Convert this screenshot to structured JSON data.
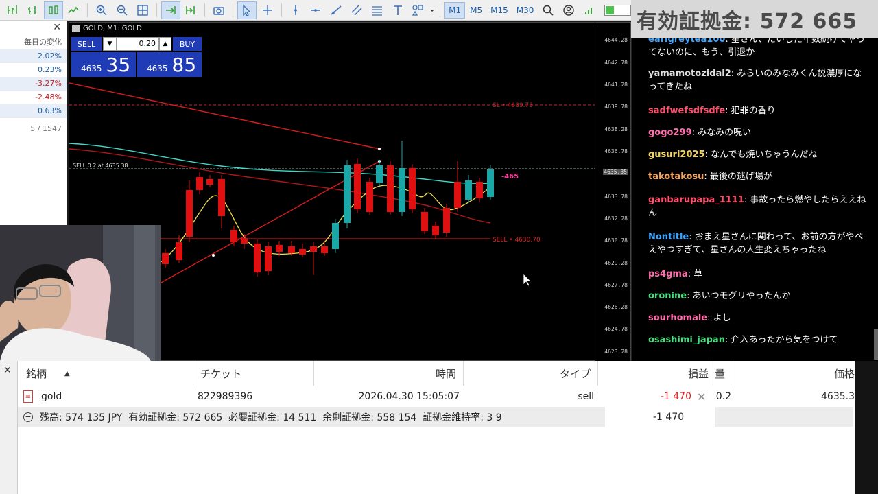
{
  "toolbar": {
    "timeframes": [
      "M1",
      "M5",
      "M15",
      "M30"
    ],
    "selected_timeframe": "M1"
  },
  "overlay": {
    "margin_text": "有効証拠金: 572 665"
  },
  "market_watch": {
    "header": "毎日の変化",
    "changes": [
      "2.02%",
      "0.23%",
      "-3.27%",
      "-2.48%",
      "0.63%"
    ],
    "footer": "5 / 1547"
  },
  "chart": {
    "title": "GOLD, M1: GOLD",
    "position_label": "SELL 0.2 at 4635.38",
    "sl_label": "SL • 4639.75",
    "sell_label": "SELL • 4630.70",
    "pnl_label": "-465",
    "price_ticks": [
      "4644.28",
      "4642.78",
      "4641.28",
      "4639.78",
      "4638.28",
      "4636.78",
      "4635.35",
      "4633.78",
      "4632.28",
      "4630.78",
      "4629.28",
      "4627.78",
      "4626.28",
      "4624.78",
      "4623.28"
    ],
    "current_price_tick": "4635.35"
  },
  "trade_panel": {
    "sell_label": "SELL",
    "buy_label": "BUY",
    "lot": "0.20",
    "sell_price_small": "4635",
    "sell_price_big": "35",
    "buy_price_small": "4635",
    "buy_price_big": "85"
  },
  "chat": {
    "messages": [
      {
        "name": "earlgreytea100",
        "text": ": 星さん、たいした年数続けてやってないのに、もう、引退か",
        "color": "#3ea6ff"
      },
      {
        "name": "yamamotozidai2",
        "text": ": みらいのみなみくん説濃厚になってきたね",
        "color": "#e0e0e0"
      },
      {
        "name": "sadfwefsdfsdfe",
        "text": ": 犯罪の香り",
        "color": "#ff4f6d"
      },
      {
        "name": "gogo299",
        "text": ": みなみの呪い",
        "color": "#ff6fae"
      },
      {
        "name": "gusuri2025",
        "text": ": なんでも焼いちゃうんだね",
        "color": "#f4d35e"
      },
      {
        "name": "takotakosu",
        "text": ": 最後の逃げ場が",
        "color": "#f4a259"
      },
      {
        "name": "ganbarupapa_1111",
        "text": ": 事故ったら燃やしたらええねん",
        "color": "#ff4f6d"
      },
      {
        "name": "Nontitle",
        "text": ": おまえ星さんに関わって、お前の方がやべえやつすぎて、星さんの人生変えちゃったね",
        "color": "#3ea6ff"
      },
      {
        "name": "ps4gma",
        "text": ": 草",
        "color": "#ff6fae"
      },
      {
        "name": "oronine",
        "text": ": あいつモグリやったんか",
        "color": "#4ade80"
      },
      {
        "name": "sourhomale",
        "text": ": よし",
        "color": "#ff6fae"
      },
      {
        "name": "osashimi_japan",
        "text": ": 介入あったから気をつけて",
        "color": "#4ade80"
      }
    ]
  },
  "terminal": {
    "columns": [
      "銘柄",
      "チケット",
      "時間",
      "タイプ",
      "損益",
      "量",
      "価格"
    ],
    "row": {
      "symbol": "gold",
      "ticket": "822989396",
      "time": "2026.04.30 15:05:07",
      "type": "sell",
      "profit": "-1 470",
      "volume": "0.2",
      "price": "4635.3"
    },
    "summary": "残高: 574 135 JPY  有効証拠金: 572 665  必要証拠金: 14 511  余剰証拠金: 558 154  証拠金維持率: 3 9",
    "summary_profit": "-1 470"
  },
  "colors": {
    "bull_candle": "#19a7a7",
    "bear_candle": "#e01010",
    "trade_panel_blue": "#1f3bb5",
    "loss_red": "#e02020"
  }
}
